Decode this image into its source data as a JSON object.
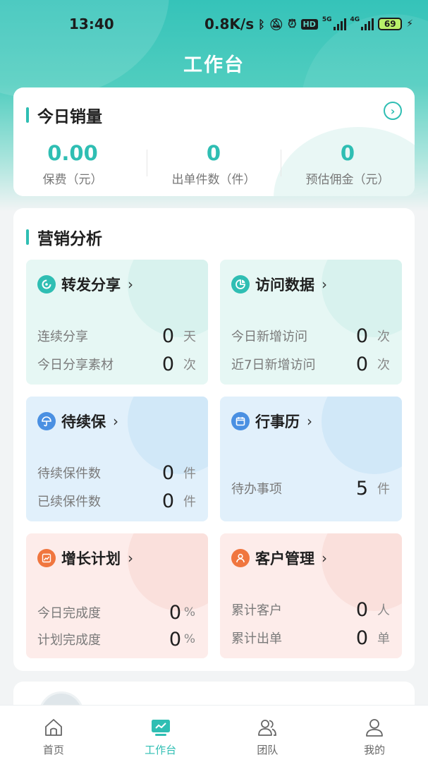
{
  "status_bar": {
    "time": "13:40",
    "speed": "0.8K/s",
    "network_tags": [
      "5G",
      "4G"
    ],
    "hd_label": "HD",
    "battery": "69"
  },
  "header": {
    "title": "工作台"
  },
  "sales": {
    "title": "今日销量",
    "stats": [
      {
        "value": "0.00",
        "label": "保费（元）"
      },
      {
        "value": "0",
        "label": "出单件数（件）"
      },
      {
        "value": "0",
        "label": "预估佣金（元）"
      }
    ]
  },
  "marketing": {
    "title": "营销分析",
    "tiles": [
      {
        "title": "转发分享",
        "icon": "share-icon",
        "rows": [
          {
            "label": "连续分享",
            "value": "0",
            "unit": "天"
          },
          {
            "label": "今日分享素材",
            "value": "0",
            "unit": "次"
          }
        ]
      },
      {
        "title": "访问数据",
        "icon": "pie-chart-icon",
        "rows": [
          {
            "label": "今日新增访问",
            "value": "0",
            "unit": "次"
          },
          {
            "label": "近7日新增访问",
            "value": "0",
            "unit": "次"
          }
        ]
      },
      {
        "title": "待续保",
        "icon": "umbrella-icon",
        "rows": [
          {
            "label": "待续保件数",
            "value": "0",
            "unit": "件"
          },
          {
            "label": "已续保件数",
            "value": "0",
            "unit": "件"
          }
        ]
      },
      {
        "title": "行事历",
        "icon": "calendar-icon",
        "rows": [
          {
            "label": "待办事项",
            "value": "5",
            "unit": "件"
          }
        ]
      },
      {
        "title": "增长计划",
        "icon": "trend-icon",
        "rows": [
          {
            "label": "今日完成度",
            "value": "0",
            "unit": "%"
          },
          {
            "label": "计划完成度",
            "value": "0",
            "unit": "%"
          }
        ]
      },
      {
        "title": "客户管理",
        "icon": "user-icon",
        "rows": [
          {
            "label": "累计客户",
            "value": "0",
            "unit": "人"
          },
          {
            "label": "累计出单",
            "value": "0",
            "unit": "单"
          }
        ]
      }
    ]
  },
  "tabbar": {
    "items": [
      {
        "label": "首页",
        "icon": "home-icon"
      },
      {
        "label": "工作台",
        "icon": "workbench-icon"
      },
      {
        "label": "团队",
        "icon": "team-icon"
      },
      {
        "label": "我的",
        "icon": "profile-icon"
      }
    ],
    "active_index": 1
  },
  "colors": {
    "accent": "#2fbeb3",
    "tile_green": "#e6f7f4",
    "tile_blue": "#e1f0fb",
    "tile_pink": "#fdecea",
    "icon_blue": "#4a90e2",
    "icon_orange": "#f0763f"
  }
}
